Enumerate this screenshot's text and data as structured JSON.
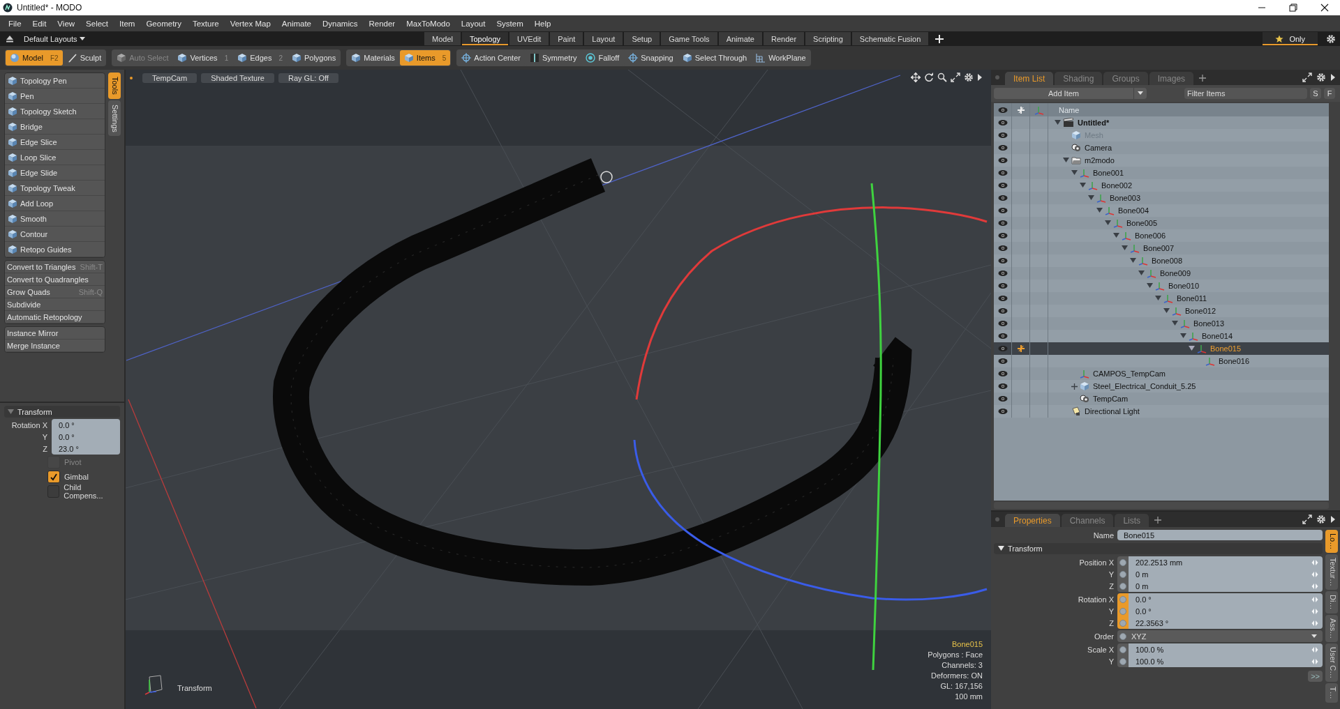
{
  "window": {
    "title": "Untitled* - MODO"
  },
  "menu": [
    "File",
    "Edit",
    "View",
    "Select",
    "Item",
    "Geometry",
    "Texture",
    "Vertex Map",
    "Animate",
    "Dynamics",
    "Render",
    "MaxToModo",
    "Layout",
    "System",
    "Help"
  ],
  "layout_bar": {
    "preset": "Default Layouts",
    "tabs": [
      {
        "label": "Model",
        "selected": false
      },
      {
        "label": "Topology",
        "selected": true
      },
      {
        "label": "UVEdit",
        "selected": false
      },
      {
        "label": "Paint",
        "selected": false
      },
      {
        "label": "Layout",
        "selected": false
      },
      {
        "label": "Setup",
        "selected": false
      },
      {
        "label": "Game Tools",
        "selected": false
      },
      {
        "label": "Animate",
        "selected": false
      },
      {
        "label": "Render",
        "selected": false
      },
      {
        "label": "Scripting",
        "selected": false
      },
      {
        "label": "Schematic Fusion",
        "selected": false
      }
    ],
    "only": "Only"
  },
  "toolbar": [
    {
      "buttons": [
        {
          "label": "Model",
          "shortcut": "F2",
          "selected": true,
          "disabled": false
        },
        {
          "label": "Sculpt",
          "selected": false,
          "disabled": false
        }
      ]
    },
    {
      "buttons": [
        {
          "label": "Auto Select",
          "selected": false,
          "disabled": true
        },
        {
          "label": "Vertices",
          "shortcut": "1",
          "selected": false,
          "disabled": false
        },
        {
          "label": "Edges",
          "shortcut": "2",
          "selected": false,
          "disabled": false
        },
        {
          "label": "Polygons",
          "selected": false,
          "disabled": false
        }
      ]
    },
    {
      "buttons": [
        {
          "label": "Materials",
          "selected": false,
          "disabled": false
        },
        {
          "label": "Items",
          "shortcut": "5",
          "selected": true,
          "disabled": false
        }
      ]
    },
    {
      "buttons": [
        {
          "label": "Action Center",
          "selected": false,
          "disabled": false
        },
        {
          "label": "Symmetry",
          "selected": false,
          "disabled": false
        },
        {
          "label": "Falloff",
          "selected": false,
          "disabled": false
        },
        {
          "label": "Snapping",
          "selected": false,
          "disabled": false
        },
        {
          "label": "Select Through",
          "selected": false,
          "disabled": false
        },
        {
          "label": "WorkPlane",
          "selected": false,
          "disabled": false
        }
      ]
    }
  ],
  "tools": {
    "tabs": [
      {
        "label": "Tools",
        "selected": true
      },
      {
        "label": "Settings",
        "selected": false
      }
    ],
    "groups": [
      {
        "kind": "icon",
        "items": [
          {
            "label": "Topology Pen"
          },
          {
            "label": "Pen"
          },
          {
            "label": "Topology Sketch"
          },
          {
            "label": "Bridge"
          },
          {
            "label": "Edge Slice"
          },
          {
            "label": "Loop Slice"
          },
          {
            "label": "Edge Slide"
          },
          {
            "label": "Topology Tweak"
          },
          {
            "label": "Add Loop"
          },
          {
            "label": "Smooth"
          },
          {
            "label": "Contour"
          },
          {
            "label": "Retopo Guides"
          }
        ]
      },
      {
        "kind": "text",
        "items": [
          {
            "label": "Convert to Triangles",
            "shortcut": "Shift-T"
          },
          {
            "label": "Convert to Quadrangles"
          },
          {
            "label": "Grow Quads",
            "shortcut": "Shift-Q"
          },
          {
            "label": "Subdivide"
          },
          {
            "label": "Automatic Retopology"
          }
        ]
      },
      {
        "kind": "text",
        "items": [
          {
            "label": "Instance Mirror"
          },
          {
            "label": "Merge Instance"
          }
        ]
      }
    ]
  },
  "transform_panel": {
    "title": "Transform",
    "rows": [
      {
        "label": "Rotation X",
        "value": "0.0 °"
      },
      {
        "label": "Y",
        "value": "0.0 °"
      },
      {
        "label": "Z",
        "value": "23.0 °"
      }
    ],
    "options": [
      {
        "label": "Pivot",
        "checked": false,
        "disabled": true
      },
      {
        "label": "Gimbal",
        "checked": true,
        "disabled": false
      },
      {
        "label": "Child Compens...",
        "checked": false,
        "disabled": false
      }
    ]
  },
  "viewport": {
    "header": [
      "TempCam",
      "Shaded Texture",
      "Ray GL: Off"
    ],
    "tool": "Transform",
    "info": {
      "item": "Bone015",
      "lines": [
        "Polygons : Face",
        "Channels: 3",
        "Deformers: ON",
        "GL: 167,156",
        "100 mm"
      ]
    }
  },
  "item_list": {
    "tabs": [
      {
        "label": "Item List",
        "selected": true
      },
      {
        "label": "Shading",
        "selected": false
      },
      {
        "label": "Groups",
        "selected": false
      },
      {
        "label": "Images",
        "selected": false
      }
    ],
    "add_item": "Add Item",
    "filter_placeholder": "Filter Items",
    "buttons": [
      "S",
      "F"
    ],
    "column": "Name",
    "tree": [
      {
        "name": "Untitled*",
        "kind": "scene",
        "selected": false,
        "disabled": false,
        "expanded": true,
        "children": [
          {
            "name": "Mesh",
            "kind": "mesh",
            "selected": false,
            "disabled": true
          },
          {
            "name": "Camera",
            "kind": "camera",
            "selected": false,
            "disabled": false
          },
          {
            "name": "m2modo",
            "kind": "group",
            "selected": false,
            "disabled": false,
            "expanded": true,
            "children": [
              {
                "name": "Bone001",
                "kind": "locator",
                "selected": false,
                "disabled": false,
                "expanded": true,
                "children": [
                  {
                    "name": "Bone002",
                    "kind": "locator",
                    "selected": false,
                    "disabled": false,
                    "expanded": true,
                    "children": [
                      {
                        "name": "Bone003",
                        "kind": "locator",
                        "selected": false,
                        "disabled": false,
                        "expanded": true,
                        "children": [
                          {
                            "name": "Bone004",
                            "kind": "locator",
                            "selected": false,
                            "disabled": false,
                            "expanded": true,
                            "children": [
                              {
                                "name": "Bone005",
                                "kind": "locator",
                                "selected": false,
                                "disabled": false,
                                "expanded": true,
                                "children": [
                                  {
                                    "name": "Bone006",
                                    "kind": "locator",
                                    "selected": false,
                                    "disabled": false,
                                    "expanded": true,
                                    "children": [
                                      {
                                        "name": "Bone007",
                                        "kind": "locator",
                                        "selected": false,
                                        "disabled": false,
                                        "expanded": true,
                                        "children": [
                                          {
                                            "name": "Bone008",
                                            "kind": "locator",
                                            "selected": false,
                                            "disabled": false,
                                            "expanded": true,
                                            "children": [
                                              {
                                                "name": "Bone009",
                                                "kind": "locator",
                                                "selected": false,
                                                "disabled": false,
                                                "expanded": true,
                                                "children": [
                                                  {
                                                    "name": "Bone010",
                                                    "kind": "locator",
                                                    "selected": false,
                                                    "disabled": false,
                                                    "expanded": true,
                                                    "children": [
                                                      {
                                                        "name": "Bone011",
                                                        "kind": "locator",
                                                        "selected": false,
                                                        "disabled": false,
                                                        "expanded": true,
                                                        "children": [
                                                          {
                                                            "name": "Bone012",
                                                            "kind": "locator",
                                                            "selected": false,
                                                            "disabled": false,
                                                            "expanded": true,
                                                            "children": [
                                                              {
                                                                "name": "Bone013",
                                                                "kind": "locator",
                                                                "selected": false,
                                                                "disabled": false,
                                                                "expanded": true,
                                                                "children": [
                                                                  {
                                                                    "name": "Bone014",
                                                                    "kind": "locator",
                                                                    "selected": false,
                                                                    "disabled": false,
                                                                    "expanded": true,
                                                                    "children": [
                                                                      {
                                                                        "name": "Bone015",
                                                                        "kind": "locator",
                                                                        "selected": true,
                                                                        "disabled": false,
                                                                        "expanded": true,
                                                                        "children": [
                                                                          {
                                                                            "name": "Bone016",
                                                                            "kind": "locator",
                                                                            "selected": false,
                                                                            "disabled": false
                                                                          }
                                                                        ]
                                                                      }
                                                                    ]
                                                                  }
                                                                ]
                                                              }
                                                            ]
                                                          }
                                                        ]
                                                      }
                                                    ]
                                                  }
                                                ]
                                              }
                                            ]
                                          }
                                        ]
                                      }
                                    ]
                                  }
                                ]
                              }
                            ]
                          }
                        ]
                      }
                    ]
                  }
                ]
              },
              {
                "name": "CAMPOS_TempCam",
                "kind": "locator",
                "selected": false,
                "disabled": false
              },
              {
                "name": "Steel_Electrical_Conduit_5.25",
                "kind": "mesh",
                "selected": false,
                "disabled": false,
                "expanded": false
              },
              {
                "name": "TempCam",
                "kind": "camera",
                "selected": false,
                "disabled": false
              }
            ]
          },
          {
            "name": "Directional Light",
            "kind": "light",
            "selected": false,
            "disabled": false
          }
        ]
      }
    ]
  },
  "properties": {
    "tabs": [
      {
        "label": "Properties",
        "selected": true
      },
      {
        "label": "Channels",
        "selected": false
      },
      {
        "label": "Lists",
        "selected": false
      }
    ],
    "name_label": "Name",
    "name_value": "Bone015",
    "section": "Transform",
    "groups": [
      {
        "kind": "fields",
        "rows": [
          {
            "label": "Position X",
            "value": "202.2513 mm",
            "keyed": false
          },
          {
            "label": "Y",
            "value": "0 m",
            "keyed": false
          },
          {
            "label": "Z",
            "value": "0 m",
            "keyed": false
          }
        ]
      },
      {
        "kind": "fields",
        "rows": [
          {
            "label": "Rotation X",
            "value": "0.0 °",
            "keyed": true
          },
          {
            "label": "Y",
            "value": "0.0 °",
            "keyed": true
          },
          {
            "label": "Z",
            "value": "22.3563 °",
            "keyed": true
          }
        ]
      },
      {
        "kind": "dropdown",
        "rows": [
          {
            "label": "Order",
            "value": "XYZ",
            "keyed": false
          }
        ]
      },
      {
        "kind": "fields",
        "rows": [
          {
            "label": "Scale X",
            "value": "100.0 %",
            "keyed": false
          },
          {
            "label": "Y",
            "value": "100.0 %",
            "keyed": false
          }
        ]
      }
    ],
    "more": ">>",
    "side_tabs": [
      {
        "label": "Lo…",
        "selected": true
      },
      {
        "label": "Textur…",
        "selected": false
      },
      {
        "label": "Di…",
        "selected": false
      },
      {
        "label": "Ass…",
        "selected": false
      },
      {
        "label": "User C…",
        "selected": false
      },
      {
        "label": "T…",
        "selected": false
      }
    ]
  }
}
